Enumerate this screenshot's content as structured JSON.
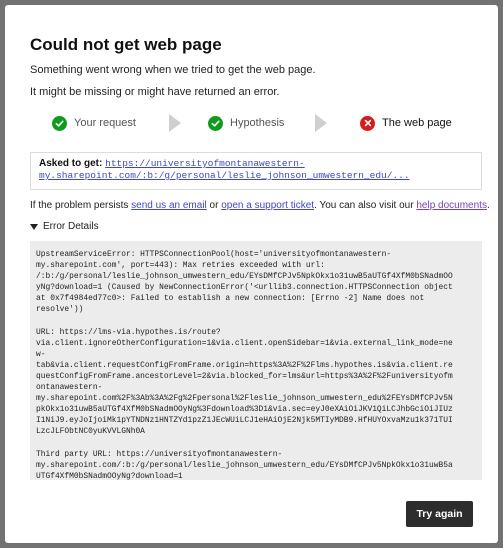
{
  "dialog": {
    "title": "Could not get web page",
    "message1": "Something went wrong when we tried to get the web page.",
    "message2": "It might be missing or might have returned an error."
  },
  "steps": [
    {
      "label": "Your request",
      "status": "done"
    },
    {
      "label": "Hypothesis",
      "status": "done"
    },
    {
      "label": "The web page",
      "status": "error"
    }
  ],
  "asked": {
    "label": "Asked to get:",
    "url_line1": "https://universityofmontanawestern-",
    "url_line2": "my.sharepoint.com/:b:/g/personal/leslie_johnson_umwestern_edu/..."
  },
  "persist": {
    "prefix": "If the problem persists ",
    "link1": "send us an email",
    "or": " or ",
    "link2": "open a support ticket",
    "mid": ". You can also visit our ",
    "link3": "help documents",
    "suffix": "."
  },
  "details": {
    "toggle_label": "Error Details",
    "block1": "UpstreamServiceError: HTTPSConnectionPool(host='universityofmontanawestern-\nmy.sharepoint.com', port=443): Max retries exceeded with url:\n/:b:/g/personal/leslie_johnson_umwestern_edu/EYsDMfCPJv5NpkOkx1o31uwB5aUTGf4XfM0bSNadmOO\nyNg?download=1 (Caused by NewConnectionError('<urllib3.connection.HTTPSConnection object\nat 0x7f4984ed77c0>: Failed to establish a new connection: [Errno -2] Name does not\nresolve'))",
    "block2": "URL: https://lms-via.hypothes.is/route?\nvia.client.ignoreOtherConfiguration=1&via.client.openSidebar=1&via.external_link_mode=ne\nw-\ntab&via.client.requestConfigFromFrame.origin=https%3A%2F%2Flms.hypothes.is&via.client.re\nquestConfigFromFrame.ancestorLevel=2&via.blocked_for=lms&url=https%3A%2F%2Funiversityofm\nontanawestern-\nmy.sharepoint.com%2F%3Ab%3A%2Fg%2Fpersonal%2Fleslie_johnson_umwestern_edu%2FEYsDMfCPJv5N\npkOkx1o31uwB5aUTGf4XfM0bSNadmOOyNg%3Fdownload%3D1&via.sec=eyJ0eXAiOiJKV1QiLCJhbGciOiJIUz\nI1NiJ9.eyJoIjoiMk1pYTNDNz1HNTZYd1pzZ1JEcWUiLCJ1eHAiOjE2Njk5MTIyMDB9.HfHUYOxvaMzu1k371TUI\nLzcJLFObtNC0yuKVVLGNh0A",
    "block3": "Third party URL: https://universityofmontanawestern-\nmy.sharepoint.com/:b:/g/personal/leslie_johnson_umwestern_edu/EYsDMfCPJv5NpkOkx1o31uwB5a\nUTGf4XfM0bSNadmOOyNg?download=1"
  },
  "buttons": {
    "try_again": "Try again"
  },
  "colors": {
    "success": "#0f9b1f",
    "error": "#d51b1b",
    "link": "#3b48c9",
    "visited_link": "#7a3fb3",
    "button_bg": "#2d2d2d"
  },
  "icons": {
    "step_done": "check-circle-icon",
    "step_error": "x-circle-icon",
    "step_separator": "arrow-right-icon",
    "details_toggle": "triangle-down-icon"
  }
}
